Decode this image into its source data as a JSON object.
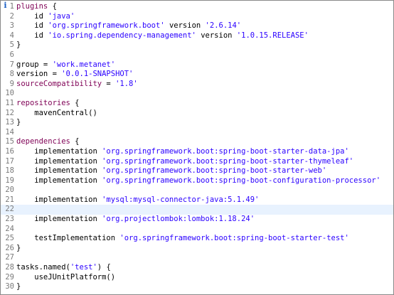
{
  "editor": {
    "marker_glyph": "i",
    "active_line": 22,
    "colors": {
      "keyword": "#7f0055",
      "string": "#2a00ff",
      "plain": "#000000",
      "line_number": "#7a7a7a",
      "active_line_bg": "#e8f2fe",
      "marker": "#1b5fc4"
    },
    "lines": [
      {
        "n": "1",
        "tokens": [
          {
            "t": "kw",
            "v": "plugins"
          },
          {
            "t": "plain",
            "v": " {"
          }
        ]
      },
      {
        "n": "2",
        "tokens": [
          {
            "t": "plain",
            "v": "    id "
          },
          {
            "t": "str",
            "v": "'java'"
          }
        ]
      },
      {
        "n": "3",
        "tokens": [
          {
            "t": "plain",
            "v": "    id "
          },
          {
            "t": "str",
            "v": "'org.springframework.boot'"
          },
          {
            "t": "plain",
            "v": " version "
          },
          {
            "t": "str",
            "v": "'2.6.14'"
          }
        ]
      },
      {
        "n": "4",
        "tokens": [
          {
            "t": "plain",
            "v": "    id "
          },
          {
            "t": "str",
            "v": "'io.spring.dependency-management'"
          },
          {
            "t": "plain",
            "v": " version "
          },
          {
            "t": "str",
            "v": "'1.0.15.RELEASE'"
          }
        ]
      },
      {
        "n": "5",
        "tokens": [
          {
            "t": "plain",
            "v": "}"
          }
        ]
      },
      {
        "n": "6",
        "tokens": []
      },
      {
        "n": "7",
        "tokens": [
          {
            "t": "plain",
            "v": "group = "
          },
          {
            "t": "str",
            "v": "'work.metanet'"
          }
        ]
      },
      {
        "n": "8",
        "tokens": [
          {
            "t": "plain",
            "v": "version = "
          },
          {
            "t": "str",
            "v": "'0.0.1-SNAPSHOT'"
          }
        ]
      },
      {
        "n": "9",
        "tokens": [
          {
            "t": "kw",
            "v": "sourceCompatibility"
          },
          {
            "t": "plain",
            "v": " = "
          },
          {
            "t": "str",
            "v": "'1.8'"
          }
        ]
      },
      {
        "n": "10",
        "tokens": []
      },
      {
        "n": "11",
        "tokens": [
          {
            "t": "kw",
            "v": "repositories"
          },
          {
            "t": "plain",
            "v": " {"
          }
        ]
      },
      {
        "n": "12",
        "tokens": [
          {
            "t": "plain",
            "v": "    mavenCentral()"
          }
        ]
      },
      {
        "n": "13",
        "tokens": [
          {
            "t": "plain",
            "v": "}"
          }
        ]
      },
      {
        "n": "14",
        "tokens": []
      },
      {
        "n": "15",
        "tokens": [
          {
            "t": "kw",
            "v": "dependencies"
          },
          {
            "t": "plain",
            "v": " {"
          }
        ]
      },
      {
        "n": "16",
        "tokens": [
          {
            "t": "plain",
            "v": "    implementation "
          },
          {
            "t": "str",
            "v": "'org.springframework.boot:spring-boot-starter-data-jpa'"
          }
        ]
      },
      {
        "n": "17",
        "tokens": [
          {
            "t": "plain",
            "v": "    implementation "
          },
          {
            "t": "str",
            "v": "'org.springframework.boot:spring-boot-starter-thymeleaf'"
          }
        ]
      },
      {
        "n": "18",
        "tokens": [
          {
            "t": "plain",
            "v": "    implementation "
          },
          {
            "t": "str",
            "v": "'org.springframework.boot:spring-boot-starter-web'"
          }
        ]
      },
      {
        "n": "19",
        "tokens": [
          {
            "t": "plain",
            "v": "    implementation "
          },
          {
            "t": "str",
            "v": "'org.springframework.boot:spring-boot-configuration-processor'"
          }
        ]
      },
      {
        "n": "20",
        "tokens": []
      },
      {
        "n": "21",
        "tokens": [
          {
            "t": "plain",
            "v": "    implementation "
          },
          {
            "t": "str",
            "v": "'mysql:mysql-connector-java:5.1.49'"
          }
        ]
      },
      {
        "n": "22",
        "tokens": []
      },
      {
        "n": "23",
        "tokens": [
          {
            "t": "plain",
            "v": "    implementation "
          },
          {
            "t": "str",
            "v": "'org.projectlombok:lombok:1.18.24'"
          }
        ]
      },
      {
        "n": "24",
        "tokens": []
      },
      {
        "n": "25",
        "tokens": [
          {
            "t": "plain",
            "v": "    testImplementation "
          },
          {
            "t": "str",
            "v": "'org.springframework.boot:spring-boot-starter-test'"
          }
        ]
      },
      {
        "n": "26",
        "tokens": [
          {
            "t": "plain",
            "v": "}"
          }
        ]
      },
      {
        "n": "27",
        "tokens": []
      },
      {
        "n": "28",
        "tokens": [
          {
            "t": "plain",
            "v": "tasks.named("
          },
          {
            "t": "str",
            "v": "'test'"
          },
          {
            "t": "plain",
            "v": ") {"
          }
        ]
      },
      {
        "n": "29",
        "tokens": [
          {
            "t": "plain",
            "v": "    useJUnitPlatform()"
          }
        ]
      },
      {
        "n": "30",
        "tokens": [
          {
            "t": "plain",
            "v": "}"
          }
        ]
      }
    ]
  }
}
